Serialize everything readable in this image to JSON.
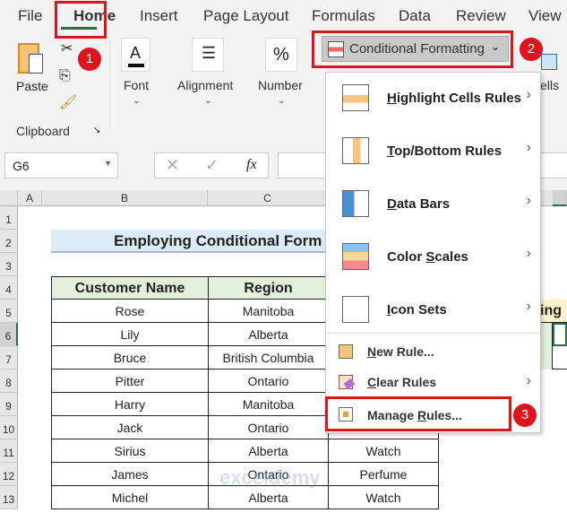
{
  "ribbon": {
    "tabs": [
      "File",
      "Home",
      "Insert",
      "Page Layout",
      "Formulas",
      "Data",
      "Review",
      "View"
    ],
    "paste": "Paste",
    "clipboard": "Clipboard",
    "font": "Font",
    "alignment": "Alignment",
    "number": "Number",
    "cells": "ells",
    "cond_fmt": "Conditional Formatting",
    "font_icon": "A",
    "number_icon": "%"
  },
  "badges": [
    "1",
    "2",
    "3"
  ],
  "formula_bar": {
    "name_box": "G6",
    "fx": "fx"
  },
  "columns": [
    "A",
    "B",
    "C"
  ],
  "rows": [
    "1",
    "2",
    "3",
    "4",
    "5",
    "6",
    "7",
    "8",
    "9",
    "10",
    "11",
    "12",
    "13"
  ],
  "sheet": {
    "title": "Employing Conditional Form",
    "headers": [
      "Customer Name",
      "Region"
    ],
    "names": [
      "Rose",
      "Lily",
      "Bruce",
      "Pitter",
      "Harry",
      "Jack",
      "Sirius",
      "James",
      "Michel"
    ],
    "regions": [
      "Manitoba",
      "Alberta",
      "British Columbia",
      "Ontario",
      "Manitoba",
      "Ontario",
      "Alberta",
      "Ontario",
      "Alberta"
    ],
    "products": [
      "Watch",
      "Perfume",
      "Watch"
    ],
    "right_header": "ing"
  },
  "menu": {
    "items": [
      {
        "pre": "",
        "u": "H",
        "post": "ighlight Cells Rules"
      },
      {
        "pre": "",
        "u": "T",
        "post": "op/Bottom Rules"
      },
      {
        "pre": "",
        "u": "D",
        "post": "ata Bars"
      },
      {
        "pre": "Color ",
        "u": "S",
        "post": "cales"
      },
      {
        "pre": "",
        "u": "I",
        "post": "con Sets"
      }
    ],
    "new_rule": {
      "pre": "",
      "u": "N",
      "post": "ew Rule..."
    },
    "clear_rules": {
      "pre": "",
      "u": "C",
      "post": "lear Rules"
    },
    "manage_rules": {
      "pre": "Manage ",
      "u": "R",
      "post": "ules..."
    }
  },
  "watermark": "exceldemy"
}
